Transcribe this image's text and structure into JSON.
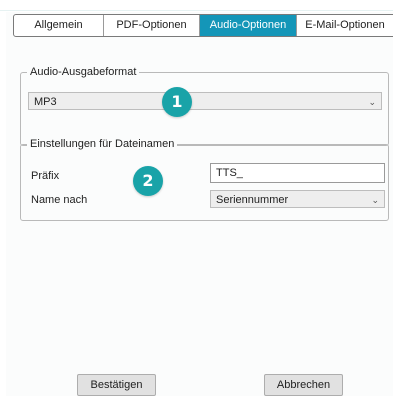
{
  "tabs": [
    {
      "label": "Allgemein",
      "active": false
    },
    {
      "label": "PDF-Optionen",
      "active": false
    },
    {
      "label": "Audio-Optionen",
      "active": true
    },
    {
      "label": "E-Mail-Optionen",
      "active": false
    }
  ],
  "audio_group": {
    "title": "Audio-Ausgabeformat",
    "format_value": "MP3",
    "badge": "1"
  },
  "filename_group": {
    "title": "Einstellungen für Dateinamen",
    "prefix_label": "Präfix",
    "prefix_value": "TTS_",
    "name_label": "Name nach",
    "name_value": "Seriennummer",
    "badge": "2"
  },
  "buttons": {
    "confirm": "Bestätigen",
    "cancel": "Abbrechen"
  },
  "colors": {
    "accent": "#1496b8",
    "badge": "#19a3a8"
  },
  "icons": {
    "dropdown": "chevron-down-icon"
  }
}
